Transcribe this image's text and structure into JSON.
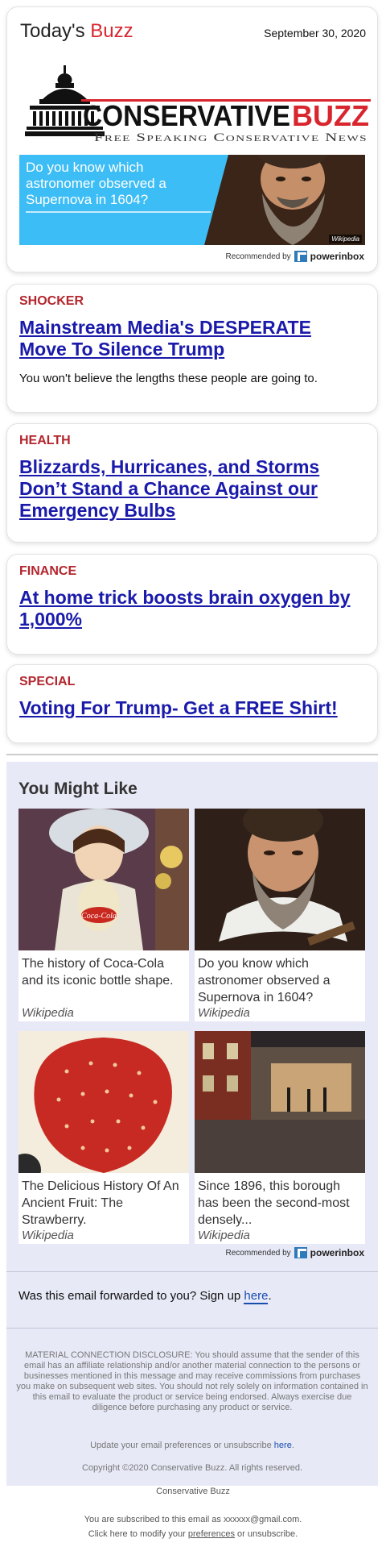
{
  "header": {
    "brand_prefix": "Today's",
    "brand_accent": "Buzz",
    "date": "September 30, 2020",
    "logo": {
      "word_left": "CONSERVATIVE",
      "word_right": "BUZZ",
      "tagline": "Free Speaking Conservative News"
    },
    "banner": {
      "text": "Do you know which astronomer observed a Supernova in 1604?",
      "credit": "Wikipedia"
    },
    "recommended_label": "Recommended by",
    "recommended_brand": "powerinbox"
  },
  "articles": [
    {
      "category": "SHOCKER",
      "headline": "Mainstream Media's DESPERATE Move To Silence Trump",
      "teaser": "You won't believe the lengths these people are going to."
    },
    {
      "category": "HEALTH",
      "headline": "Blizzards, Hurricanes, and Storms Don’t Stand a Chance Against our Emergency Bulbs"
    },
    {
      "category": "FINANCE",
      "headline": "At home trick boosts brain oxygen by 1,000%"
    },
    {
      "category": "SPECIAL",
      "headline": "Voting For Trump- Get a FREE Shirt!"
    }
  ],
  "you_might_like": {
    "title": "You Might Like",
    "tiles": [
      {
        "title": "The history of Coca-Cola and its iconic bottle shape.",
        "source": "Wikipedia"
      },
      {
        "title": "Do you know which astronomer observed a Supernova in 1604?",
        "source": "Wikipedia"
      },
      {
        "title": "The Delicious History Of An Ancient Fruit: The Strawberry.",
        "source": "Wikipedia"
      },
      {
        "title": "Since 1896, this borough has been the second-most densely...",
        "source": "Wikipedia"
      }
    ],
    "recommended_label": "Recommended by",
    "recommended_brand": "powerinbox",
    "forward_text": "Was this email forwarded to you? Sign up",
    "forward_link": "here",
    "disclosure": "MATERIAL CONNECTION DISCLOSURE: You should assume that the sender of this email has an affiliate relationship and/or another material connection to the persons or businesses mentioned in this message and may receive commissions from purchases you make on subsequent web sites. You should not rely solely on information contained in this email to evaluate the product or service being endorsed. Always exercise due diligence before purchasing any product or service.",
    "prefs_text": "Update your email preferences or unsubscribe",
    "prefs_link": "here",
    "copyright": "Copyright ©2020 Conservative Buzz. All rights reserved."
  },
  "footer": {
    "company": "Conservative Buzz",
    "subscribed": "You are subscribed to this email as xxxxxx@gmail.com.",
    "modify_prefix": "Click here to modify your",
    "modify_link": "preferences",
    "modify_suffix": "or unsubscribe."
  },
  "colors": {
    "accent_red": "#d8262e",
    "category_red": "#b3262e",
    "headline_blue": "#1a1aab",
    "banner_blue": "#3dbdf5",
    "section_bg": "#e7e9f6"
  }
}
